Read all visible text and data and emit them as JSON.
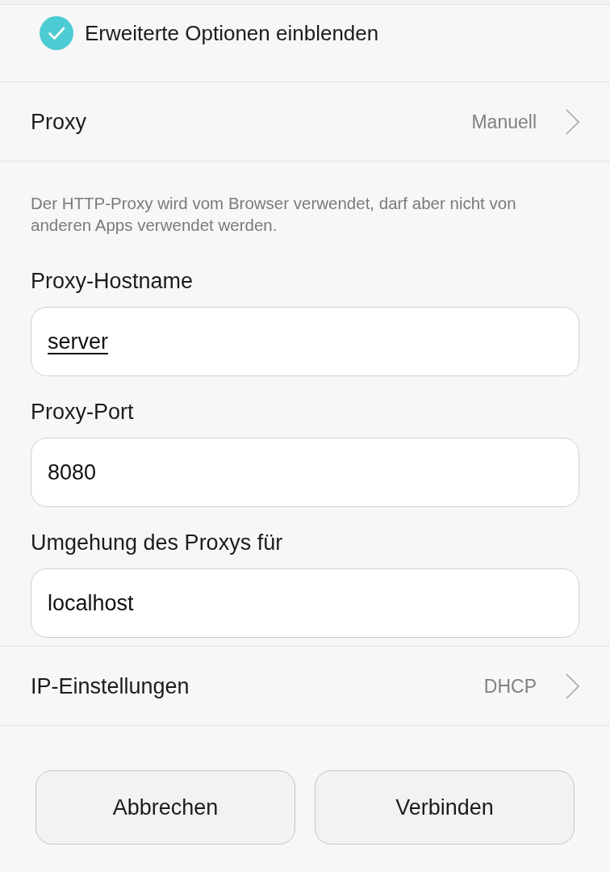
{
  "checkbox": {
    "label": "Erweiterte Optionen einblenden",
    "checked": true
  },
  "proxy_row": {
    "label": "Proxy",
    "value": "Manuell"
  },
  "proxy_note": "Der HTTP-Proxy wird vom Browser verwendet, darf aber nicht von anderen Apps verwendet werden.",
  "fields": [
    {
      "label": "Proxy-Hostname",
      "value": "server",
      "underlined": true
    },
    {
      "label": "Proxy-Port",
      "value": "8080",
      "underlined": false
    },
    {
      "label": "Umgehung des Proxys für",
      "value": "localhost",
      "underlined": false
    }
  ],
  "ip_row": {
    "label": "IP-Einstellungen",
    "value": "DHCP"
  },
  "buttons": [
    "Abbrechen",
    "Verbinden"
  ]
}
